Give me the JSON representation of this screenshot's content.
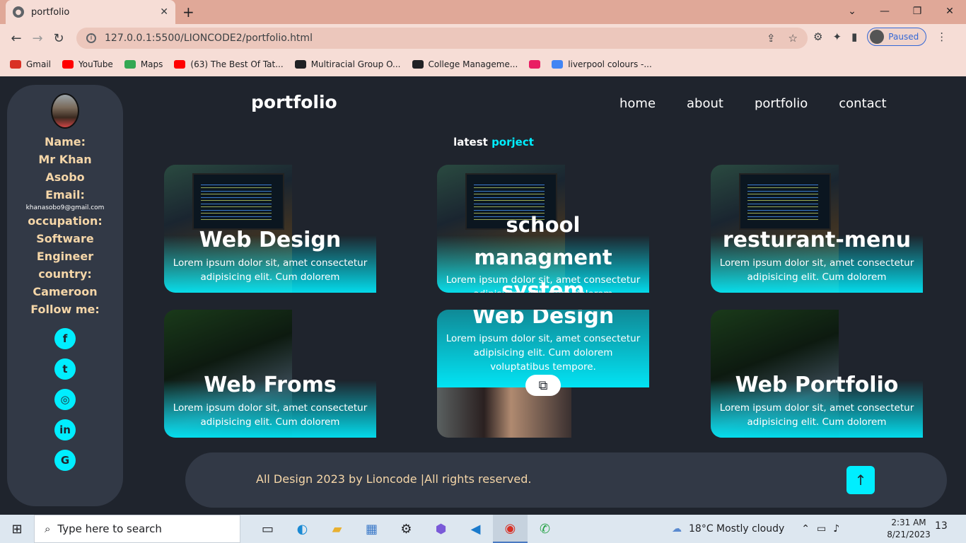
{
  "browser": {
    "tab_title": "portfolio",
    "tab_close": "✕",
    "new_tab": "+",
    "url": "127.0.0.1:5500/LIONCODE2/portfolio.html",
    "profile_status": "Paused",
    "window_controls": [
      "⌄",
      "—",
      "❐",
      "✕"
    ],
    "bookmarks": [
      {
        "label": "Gmail",
        "color": "#d93025"
      },
      {
        "label": "YouTube",
        "color": "#ff0000"
      },
      {
        "label": "Maps",
        "color": "#34a853"
      },
      {
        "label": "(63) The Best Of Tat...",
        "color": "#ff0000"
      },
      {
        "label": "Multiracial Group O...",
        "color": "#202124"
      },
      {
        "label": "College Manageme...",
        "color": "#202124"
      },
      {
        "label": "",
        "color": "#e91e63"
      },
      {
        "label": "liverpool colours -...",
        "color": "#4285f4"
      }
    ]
  },
  "profile": {
    "name_label": "Name:",
    "name": "Mr Khan Asobo",
    "email_label": "Email:",
    "email": "khanasobo9@gmail.com",
    "occupation_label": "occupation:",
    "occupation": "Software Engineer",
    "country_label": "country:",
    "country": "Cameroon",
    "follow_label": "Follow me:",
    "socials": [
      {
        "icon": "facebook-icon",
        "glyph": "f"
      },
      {
        "icon": "twitter-icon",
        "glyph": "t"
      },
      {
        "icon": "instagram-icon",
        "glyph": "◎"
      },
      {
        "icon": "linkedin-icon",
        "glyph": "in"
      },
      {
        "icon": "google-icon",
        "glyph": "G"
      }
    ]
  },
  "header": {
    "logo": "portfolio",
    "nav": [
      "home",
      "about",
      "portfolio",
      "contact"
    ]
  },
  "section": {
    "title_main": "latest",
    "title_accent": "porject"
  },
  "projects": [
    {
      "title": "Web Design",
      "desc": "Lorem ipsum dolor sit, amet consectetur adipisicing elit. Cum dolorem voluptatibus tempore."
    },
    {
      "title": "school managment system",
      "desc": "Lorem ipsum dolor sit, amet consectetur adipisicing elit. Cum dolorem voluptatibus tempore."
    },
    {
      "title": "resturant-menu",
      "desc": "Lorem ipsum dolor sit, amet consectetur adipisicing elit. Cum dolorem voluptatibus tempore."
    },
    {
      "title": "Web Froms",
      "desc": "Lorem ipsum dolor sit, amet consectetur adipisicing elit. Cum dolorem voluptatibus tempore."
    },
    {
      "title": "Web Design",
      "desc": "Lorem ipsum dolor sit, amet consectetur adipisicing elit. Cum dolorem voluptatibus tempore."
    },
    {
      "title": "Web Portfolio",
      "desc": "Lorem ipsum dolor sit, amet consectetur adipisicing elit. Cum dolorem voluptatibus tempore."
    }
  ],
  "footer": {
    "text": "All Design 2023 by Lioncode |All rights reserved.",
    "up_glyph": "↑"
  },
  "taskbar": {
    "search_placeholder": "Type here to search",
    "weather": "18°C  Mostly cloudy",
    "time": "2:31 AM",
    "date": "8/21/2023",
    "notifications": "13"
  },
  "colors": {
    "accent": "#00eeff",
    "bg": "#1f242d",
    "panel": "#323946",
    "label": "#f5d6a8"
  }
}
